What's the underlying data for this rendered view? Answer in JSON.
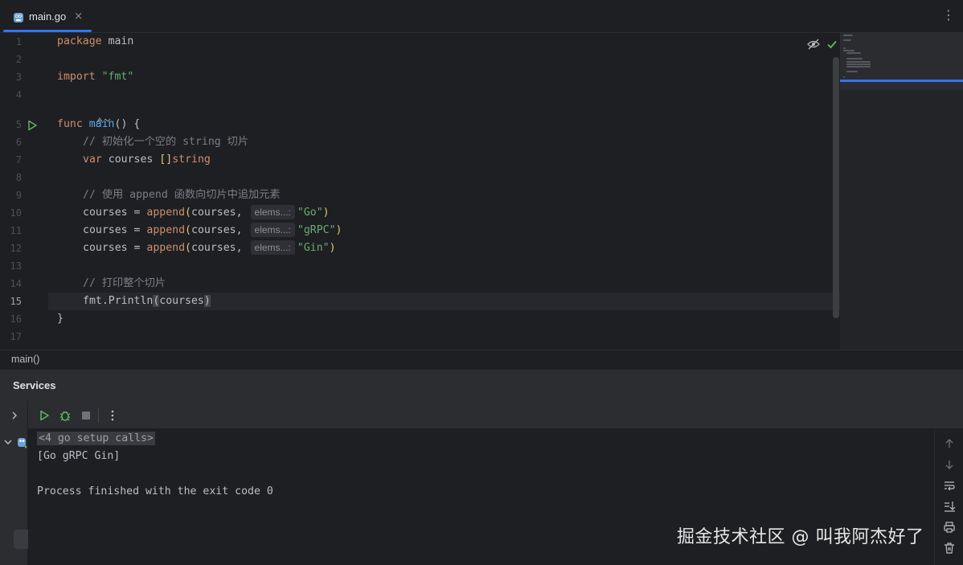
{
  "tab": {
    "label": "main.go",
    "close": "×"
  },
  "menu": {
    "kebab": "⋮"
  },
  "editor": {
    "lines": [
      {
        "n": "1"
      },
      {
        "n": "2"
      },
      {
        "n": "3"
      },
      {
        "n": "4"
      },
      {
        "n": "5"
      },
      {
        "n": "6"
      },
      {
        "n": "7"
      },
      {
        "n": "8"
      },
      {
        "n": "9"
      },
      {
        "n": "10"
      },
      {
        "n": "11"
      },
      {
        "n": "12"
      },
      {
        "n": "13"
      },
      {
        "n": "14"
      },
      {
        "n": "15"
      },
      {
        "n": "16"
      },
      {
        "n": "17"
      }
    ],
    "tokens": {
      "package_kw": "package",
      "package_name": " main",
      "import_kw": "import",
      "import_path": "\"fmt\"",
      "func_kw": "func",
      "main_fn": "main",
      "open_paren": "(",
      "close_paren": ")",
      "open_brace": " {",
      "comment1": "// 初始化一个空的 string 切片",
      "var_kw": "var",
      "courses_decl": " courses ",
      "slice_brackets": "[]",
      "string_type": "string",
      "comment2": "// 使用 append 函数向切片中追加元素",
      "assign": "courses = ",
      "append_fn": "append",
      "courses_arg": "courses,",
      "hint": "elems...:",
      "val_go": "\"Go\"",
      "val_grpc": "\"gRPC\"",
      "val_gin": "\"Gin\"",
      "comment3": "// 打印整个切片",
      "fmt_pkg": "fmt.",
      "println_fn": "Println",
      "courses_plain": "courses",
      "close_brace": "}"
    }
  },
  "breadcrumb": "main()",
  "services": {
    "title": "Services",
    "console": {
      "setup": "<4 go setup calls>",
      "output": "[Go gRPC Gin]",
      "finished": "Process finished with the exit code 0"
    }
  },
  "watermark": "掘金技术社区 @ 叫我阿杰好了",
  "icons": [
    "go-file-icon",
    "run-gutter-icon",
    "hide-icon",
    "check-icon",
    "run-icon",
    "debug-icon",
    "stop-icon",
    "chevron-right-icon",
    "chevron-down-icon",
    "arrow-up-icon",
    "arrow-down-icon",
    "soft-wrap-icon",
    "scroll-to-end-icon",
    "print-icon",
    "trash-icon"
  ],
  "colors": {
    "accent": "#3574f0",
    "keyword": "#cf8e6d",
    "function": "#56a8f5",
    "string": "#6aab73",
    "comment": "#7a7e85",
    "run": "#5fb865"
  }
}
